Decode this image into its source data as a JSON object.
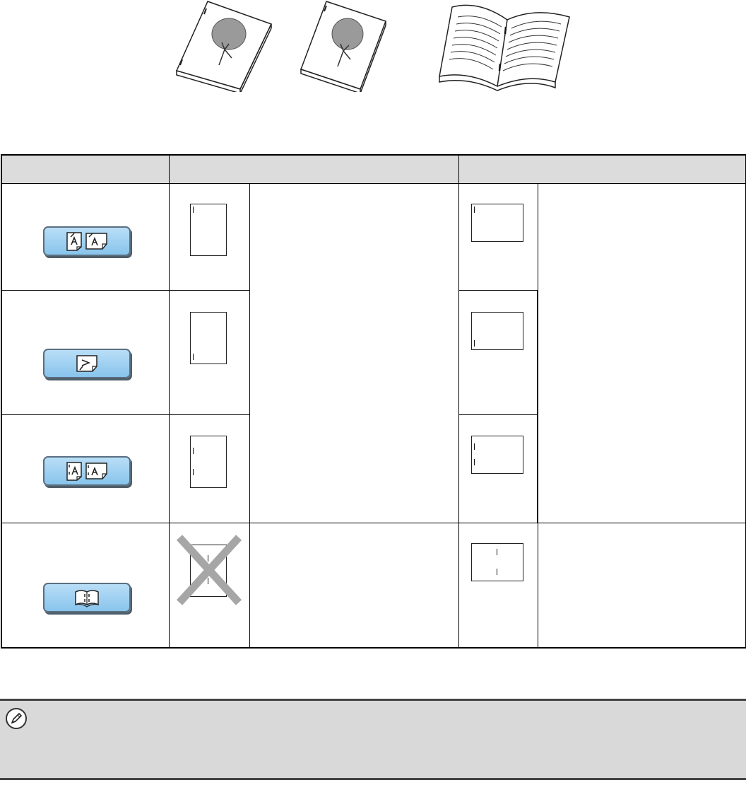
{
  "icons": {
    "illustrations": [
      "stapled-document-icon",
      "stapled-document-icon",
      "open-booklet-icon"
    ],
    "staple_modes": [
      "staple-one-icon",
      "staple-one-corner-icon",
      "staple-two-icon",
      "saddle-stitch-icon"
    ],
    "note": "pencil-note-icon",
    "not_allowed": "x-mark-icon"
  },
  "colors": {
    "header_bg": "#dcdcdc",
    "button_fill": "#9ccff1",
    "note_bg": "#d9d9d9",
    "x_mark": "#a6a6a6"
  }
}
